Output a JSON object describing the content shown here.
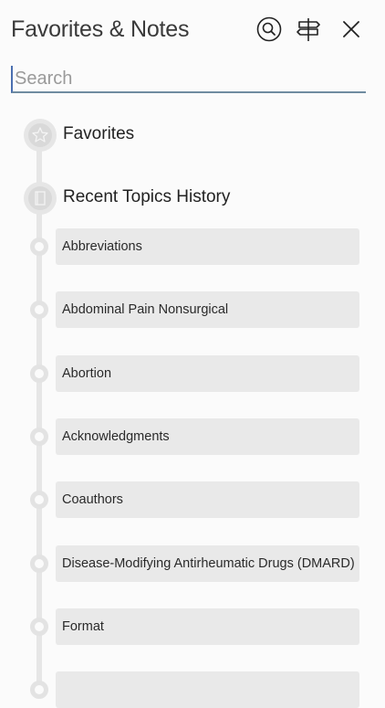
{
  "header": {
    "title": "Favorites & Notes"
  },
  "search": {
    "placeholder": "Search",
    "value": ""
  },
  "sections": {
    "favorites": "Favorites",
    "recent": "Recent Topics History"
  },
  "items": [
    "Abbreviations",
    "Abdominal Pain Nonsurgical",
    "Abortion",
    "Acknowledgments",
    "Coauthors",
    "Disease-Modifying Antirheumatic Drugs (DMARD)",
    "Format",
    ""
  ],
  "icons": {
    "search": "search-icon",
    "signpost": "signpost-icon",
    "close": "close-icon",
    "star": "star-icon",
    "book": "book-icon"
  }
}
